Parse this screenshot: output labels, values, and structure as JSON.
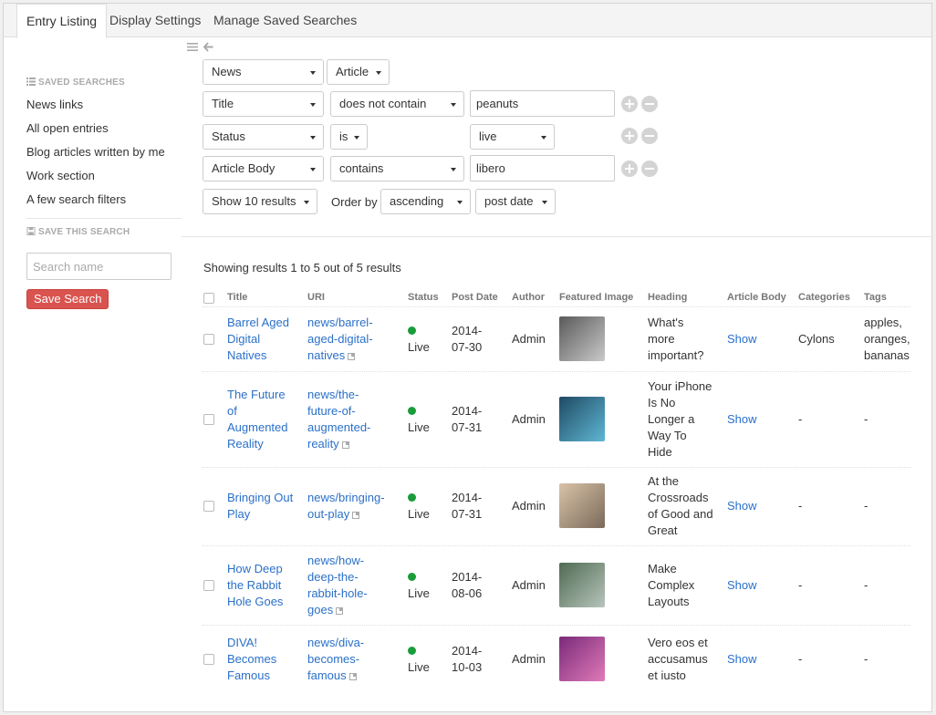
{
  "tabs": [
    {
      "label": "Entry Listing",
      "active": true
    },
    {
      "label": "Display Settings",
      "active": false
    },
    {
      "label": "Manage Saved Searches",
      "active": false
    }
  ],
  "toolbar_icons": [
    "list-icon",
    "arrow-left-icon"
  ],
  "sidebar": {
    "saved_heading": "SAVED SEARCHES",
    "saved_items": [
      "News links",
      "All open entries",
      "Blog articles written by me",
      "Work section",
      "A few search filters"
    ],
    "save_heading": "SAVE THIS SEARCH",
    "search_name_placeholder": "Search name",
    "save_button": "Save Search"
  },
  "filters": {
    "channel": "News",
    "type": "Article",
    "rows": [
      {
        "field": "Title",
        "operator": "does not contain",
        "value": "peanuts"
      },
      {
        "field": "Status",
        "operator": "is",
        "value": "live"
      },
      {
        "field": "Article Body",
        "operator": "contains",
        "value": "libero"
      }
    ],
    "show_results": "Show 10 results",
    "order_by_label": "Order by",
    "order_direction": "ascending",
    "order_field": "post date"
  },
  "results": {
    "summary": "Showing results 1 to 5 out of 5 results",
    "columns": [
      "Title",
      "URI",
      "Status",
      "Post Date",
      "Author",
      "Featured Image",
      "Heading",
      "Article Body",
      "Categories",
      "Tags"
    ],
    "rows": [
      {
        "title": [
          "Barrel Aged",
          "Digital",
          "Natives"
        ],
        "uri": [
          "news/barrel-",
          "aged-digital-",
          "natives"
        ],
        "status": "Live",
        "date": [
          "2014-",
          "07-30"
        ],
        "author": "Admin",
        "heading": [
          "What's",
          "more",
          "important?"
        ],
        "body": "Show",
        "categories": "Cylons",
        "tags": [
          "apples,",
          "oranges,",
          "bananas"
        ],
        "img_colors": [
          "#5a5a5a",
          "#c9c9c9"
        ]
      },
      {
        "title": [
          "The Future",
          "of",
          "Augmented",
          "Reality"
        ],
        "uri": [
          "news/the-",
          "future-of-",
          "augmented-",
          "reality"
        ],
        "status": "Live",
        "date": [
          "2014-",
          "07-31"
        ],
        "author": "Admin",
        "heading": [
          "Your iPhone",
          "Is No",
          "Longer a",
          "Way To",
          "Hide"
        ],
        "body": "Show",
        "categories": "-",
        "tags": [
          "-"
        ],
        "img_colors": [
          "#1f4a63",
          "#5fb7d4"
        ]
      },
      {
        "title": [
          "Bringing Out",
          "Play"
        ],
        "uri": [
          "news/bringing-",
          "out-play"
        ],
        "status": "Live",
        "date": [
          "2014-",
          "07-31"
        ],
        "author": "Admin",
        "heading": [
          "At the",
          "Crossroads",
          "of Good and",
          "Great"
        ],
        "body": "Show",
        "categories": "-",
        "tags": [
          "-"
        ],
        "img_colors": [
          "#d9c3a8",
          "#7a6a5a"
        ]
      },
      {
        "title": [
          "How Deep",
          "the Rabbit",
          "Hole Goes"
        ],
        "uri": [
          "news/how-",
          "deep-the-",
          "rabbit-hole-",
          "goes"
        ],
        "status": "Live",
        "date": [
          "2014-",
          "08-06"
        ],
        "author": "Admin",
        "heading": [
          "Make",
          "Complex",
          "Layouts"
        ],
        "body": "Show",
        "categories": "-",
        "tags": [
          "-"
        ],
        "img_colors": [
          "#4f6b52",
          "#b8c4bc"
        ]
      },
      {
        "title": [
          "DIVA!",
          "Becomes",
          "Famous"
        ],
        "uri": [
          "news/diva-",
          "becomes-",
          "famous"
        ],
        "status": "Live",
        "date": [
          "2014-",
          "10-03"
        ],
        "author": "Admin",
        "heading": [
          "Vero eos et",
          "accusamus",
          "et iusto"
        ],
        "body": "Show",
        "categories": "-",
        "tags": [
          "-"
        ],
        "img_colors": [
          "#7a2a7a",
          "#e07ab8"
        ]
      }
    ]
  },
  "colors": {
    "accent_link": "#2b70c8",
    "danger": "#d9534f",
    "live_status": "#1a9c3a"
  }
}
